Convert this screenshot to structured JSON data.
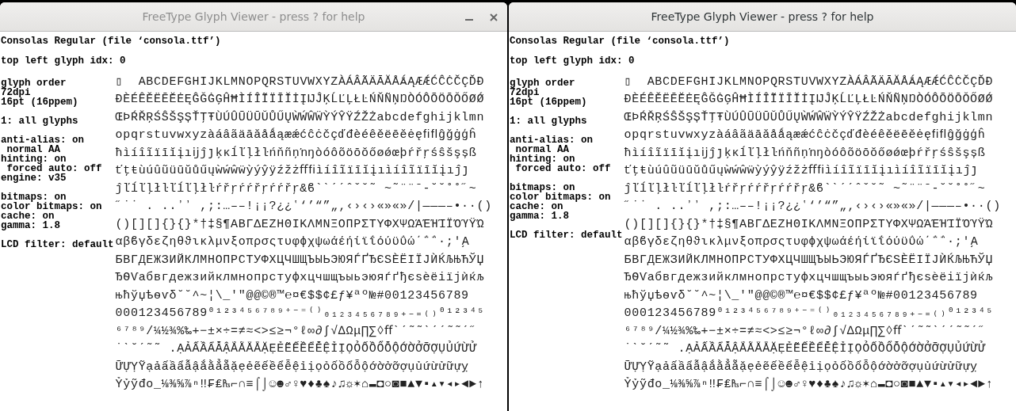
{
  "windows": [
    {
      "title": "FreeType Glyph Viewer - press ? for help",
      "active": false,
      "controls": true,
      "header_lines": [
        "Consolas Regular (file ‘consola.ttf’)",
        "top left glyph idx: 0"
      ],
      "sidebar_groups": [
        [
          "glyph order",
          "72dpi",
          "16pt (16ppem)"
        ],
        [
          "1: all glyphs"
        ],
        [
          "anti-alias: on",
          " normal AA",
          "hinting: on",
          " forced auto: off",
          "engine: v35"
        ],
        [
          "bitmaps: on",
          "color bitmaps: on",
          "cache: on",
          "gamma: 1.8"
        ],
        [
          "LCD filter: default"
        ]
      ],
      "glyph_rows": [
        "▯  ABCDEFGHIJKLMNOPQRSTUVWXYZÀÁÂÃÄĀĂÅǺĄÆǼĆĈĊČÇĎĐ",
        "ĐÈÉÊĚËĒĔĖĘĜĞĠĢĤĦÌÍÎĨÏĪĬİĮĲĴĶĹĽĻŁĿŃŇÑŅŊÒÓÔÕÖŌŎŐØǾ",
        "ŒÞŔŘŖŚŜŠŞȘŤŢŦÙÚÛŨÜŪŬŮŰŲẀẂŴẄỲÝŶŸŹŽŻabcdefghijklmn",
        "opqrstuvwxyzàáâãäāăåǻąæǽćĉċčçďđèéêěëēĕėęﬁﬂĝğġģĥ",
        "ħìíîĩïīĭįıĳĵȷķĸĺľļłŀńňñņŉŋòóôõöōŏőøǿœþŕřŗśŝšşșß",
        "ťţŧùúûũüūŭůűųẁẃŵẅỳýŷÿźžżﬀﬁìíîĩïīĭįıìíîĩïīĭįıĵȷ",
        "ĵľĺľļłŀľĺľļłŀŕřŗŕŕřŗŕŕřŗ&ϐ`ˋˊˊˆˇ˘˜ ~˜¨¨ˉ-˘˘˚˚˝~",
        "˝˙˙ . ..ʼʼ ,;:…––!¡¡?¿¿ʽ‘’“”„‚‹›‹›«»«»/|———–•··()",
        "()[][]{}{}*†‡§¶ΑΒΓΔΕΖΗΘΙΚΛΜΝΞΟΠΡΣΤΥΦΧΨΩΆΈΉΊΪΌΎΫΏ",
        "αβϐγδεζηθϑικλμνξοπρσςτυφϕχψωάέήίϊΐόύϋΰώ΄΅΅·;ʹ͵Α",
        "БВГДЕЖЗИЙКЛМНОПРСТУФХЦЧШЩЪЫЬЭЮЯЃҐЂЄЅЀЁІЇЈЍЌЉЊЋЎЏ",
        "ЂѲѴабвгдежзийклмнопрстуфхцчшщъыьэюяѓґђєѕѐёіїјѝќљ",
        "њћўџѣѳѵδ˘˘^~¦\\_'\"@@©®™℮¤€$$¢£ƒ¥ªº№#00123456789",
        "000123456789⁰¹²³⁴⁵⁶⁷⁸⁹⁺⁻⁼⁽⁾₀₁₂₃₄₅₆₇₈₉₊₋₌₍₎⁰¹²³⁴⁵",
        "⁶⁷⁸⁹/¼½¾%‰+−±×÷=≠≈<>≤≥¬°ℓ∞∂∫√∆Ωμ∏∑◊ﬀˋˊ˜˜ˋˊˊ˜˜ˊ˝",
        "˙ˋ˘ˊ˜˜ .ẠẢẤẦẨẪẬẮẰẲẴẶẸẺẼẾỀỂỄỆỈỊỌỎỐỒỔỖỘỚỜỞỠỢỤỦỨỪỬ",
        "ỮỰỴỸạảấầẩẫậắằẳẵặẹẻẽếềểễệỉịọỏốồổỗộớờởỡợụủứừửữựỵ",
        "Ỷỷỹđo_⅛⅜⅝⅞ⁿ‼₣₤₧⌐∩≡⌠⌡☺☻♂♀♥♦♣♠♪♫☼✶⌂▬◘○◙■▲▼▪▴▾◂▸◄►↑"
      ]
    },
    {
      "title": "FreeType Glyph Viewer - press ? for help",
      "active": true,
      "controls": false,
      "header_lines": [
        "Consolas Regular (file ‘consola.ttf’)",
        "top left glyph idx: 0"
      ],
      "sidebar_groups": [
        [
          "glyph order",
          "72dpi",
          "16pt (16ppem)"
        ],
        [
          "1: all glyphs"
        ],
        [
          "anti-alias: on",
          " normal AA",
          "hinting: on",
          " forced auto: off"
        ],
        [
          "bitmaps: on",
          "color bitmaps: on",
          "cache: on",
          "gamma: 1.8"
        ],
        [
          "LCD filter: default"
        ]
      ],
      "glyph_rows": [
        "▯  ABCDEFGHIJKLMNOPQRSTUVWXYZÀÁÂÃÄĀĂÅǺĄÆǼĆĈĊČÇĎĐ",
        "ĐÈÉÊĚËĒĔĖĘĜĞĠĢĤĦÌÍÎĨÏĪĬİĮĲĴĶĹĽĻŁĿŃŇÑŅŊÒÓÔÕÖŌŎŐØǾ",
        "ŒÞŔŘŖŚŜŠŞȘŤŢŦÙÚÛŨÜŪŬŮŰŲẀẂŴẄỲÝŶŸŹŽŻabcdefghijklmn",
        "opqrstuvwxyzàáâãäāăåǻąæǽćĉċčçďđèéêěëēĕėęﬁﬂĝğġģĥ",
        "ħìíîĩïīĭįıĳĵȷķĸĺľļłŀńňñņŉŋòóôõöōŏőøǿœþŕřŗśŝšşșß",
        "ťţŧùúûũüūŭůűųẁẃŵẅỳýŷÿźžżﬀﬁìíîĩïīĭįıìíîĩïīĭįıĵȷ",
        "ĵľĺľļłŀľĺľļłŀŕřŗŕŕřŗŕŕřŗ&ϐ`ˋˊˊˆˇ˘˜ ~˜¨¨ˉ-˘˘˚˚˝~",
        "˝˙˙ . ..ʼʼ ,;:…––!¡¡?¿¿ʽ‘’“”„‚‹›‹›«»«»/|———–•··()",
        "()[][]{}{}*†‡§¶ΑΒΓΔΕΖΗΘΙΚΛΜΝΞΟΠΡΣΤΥΦΧΨΩΆΈΉΊΪΌΎΫΏ",
        "αβϐγδεζηθϑικλμνξοπρσςτυφϕχψωάέήίϊΐόύϋΰώ΄΅΅·;ʹ͵Α",
        "БВГДЕЖЗИЙКЛМНОПРСТУФХЦЧШЩЪЫЬЭЮЯЃҐЂЄЅЀЁІЇЈЍЌЉЊЋЎЏ",
        "ЂѲѴабвгдежзийклмнопрстуфхцчшщъыьэюяѓґђєѕѐёіїјѝќљ",
        "њћўџѣѳѵδ˘˘^~¦\\_'\"@@©®™℮¤€$$¢£ƒ¥ªº№#00123456789",
        "000123456789⁰¹²³⁴⁵⁶⁷⁸⁹⁺⁻⁼⁽⁾₀₁₂₃₄₅₆₇₈₉₊₋₌₍₎⁰¹²³⁴⁵",
        "⁶⁷⁸⁹/¼½¾%‰+−±×÷=≠≈<>≤≥¬°ℓ∞∂∫√∆Ωμ∏∑◊ﬀˋˊ˜˜ˋˊˊ˜˜ˊ˝",
        "˙ˋ˘ˊ˜˜ .ẠẢẤẦẨẪẬẮẰẲẴẶẸẺẼẾỀỂỄỆỈỊỌỎỐỒỔỖỘỚỜỞỠỢỤỦỨỪỬ",
        "ỮỰỴỸạảấầẩẫậắằẳẵặẹẻẽếềểễệỉịọỏốồổỗộớờởỡợụủứừửữựỵ",
        "Ỷỷỹđo_⅛⅜⅝⅞ⁿ‼₣₤₧⌐∩≡⌠⌡☺☻♂♀♥♦♣♠♪♫☼✶⌂▬◘○◙■▲▼▪▴▾◂▸◄►↑"
      ]
    }
  ]
}
